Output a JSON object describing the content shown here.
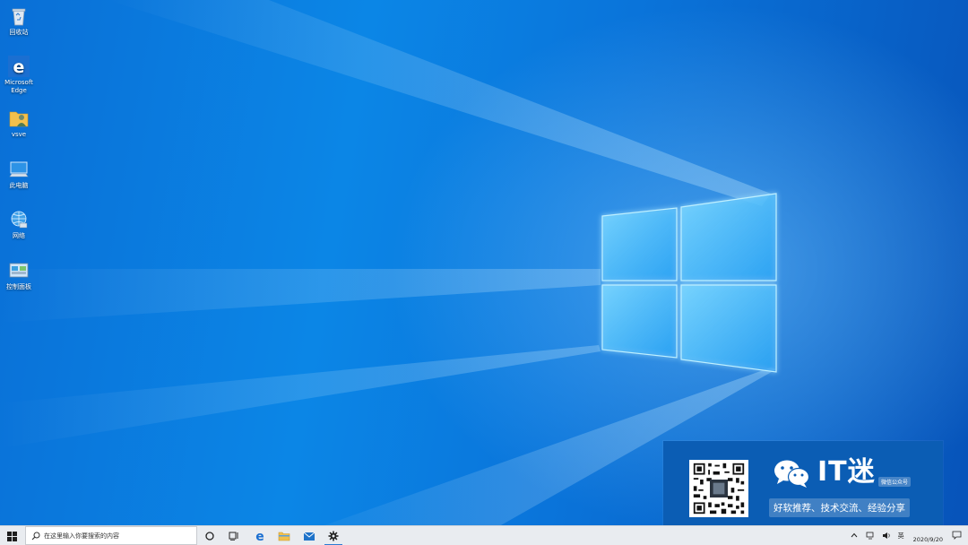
{
  "desktop": {
    "icons": [
      {
        "label": "回收站",
        "icon": "recycle-bin-icon"
      },
      {
        "label": "Microsoft Edge",
        "icon": "edge-icon"
      },
      {
        "label": "vsve",
        "icon": "user-folder-icon"
      },
      {
        "label": "此电脑",
        "icon": "computer-icon"
      },
      {
        "label": "网络",
        "icon": "network-icon"
      },
      {
        "label": "控制面板",
        "icon": "control-panel-icon"
      }
    ]
  },
  "taskbar": {
    "start": "windows-start-icon",
    "search_placeholder": "在这里输入你要搜索的内容",
    "apps": [
      {
        "name": "cortana",
        "icon": "cortana-icon"
      },
      {
        "name": "task-view",
        "icon": "task-view-icon"
      },
      {
        "name": "edge",
        "icon": "edge-icon"
      },
      {
        "name": "file-explorer",
        "icon": "folder-icon"
      },
      {
        "name": "mail",
        "icon": "mail-icon"
      },
      {
        "name": "settings",
        "icon": "gear-icon",
        "active": true
      }
    ],
    "tray": {
      "ime": "英",
      "date": "2020/9/20"
    }
  },
  "watermark": {
    "brand": "IT迷",
    "badge": "微信公众号",
    "slogan": "好软推荐、技术交流、经验分享"
  },
  "colors": {
    "wallpaper_blue": "#0b86e6",
    "taskbar_bg": "#e9ecf0",
    "accent": "#2b7cd3",
    "watermark_bg": "#0b5db4"
  }
}
